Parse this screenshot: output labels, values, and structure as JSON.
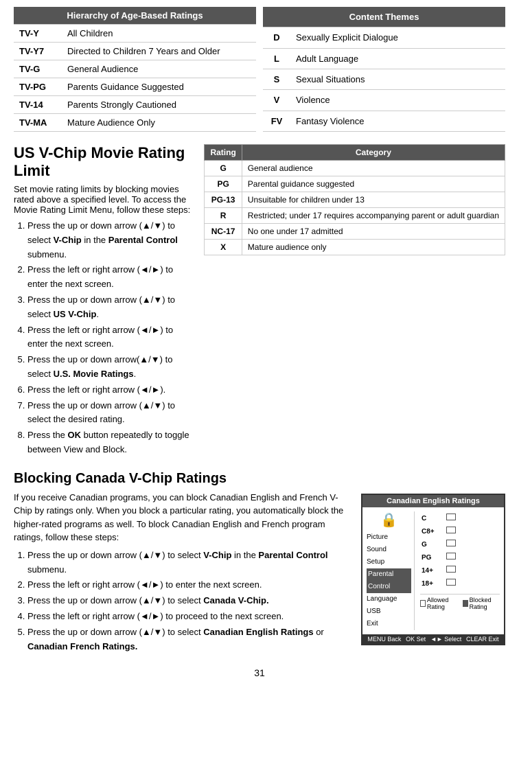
{
  "hierarchy_table": {
    "header": "Hierarchy of Age-Based Ratings",
    "rows": [
      {
        "rating": "TV-Y",
        "desc": "All Children"
      },
      {
        "rating": "TV-Y7",
        "desc": "Directed to Children 7 Years and Older"
      },
      {
        "rating": "TV-G",
        "desc": "General Audience"
      },
      {
        "rating": "TV-PG",
        "desc": "Parents Guidance Suggested"
      },
      {
        "rating": "TV-14",
        "desc": "Parents Strongly Cautioned"
      },
      {
        "rating": "TV-MA",
        "desc": "Mature Audience Only"
      }
    ]
  },
  "content_themes_table": {
    "header": "Content Themes",
    "rows": [
      {
        "rating": "D",
        "desc": "Sexually Explicit Dialogue"
      },
      {
        "rating": "L",
        "desc": "Adult Language"
      },
      {
        "rating": "S",
        "desc": "Sexual Situations"
      },
      {
        "rating": "V",
        "desc": "Violence"
      },
      {
        "rating": "FV",
        "desc": "Fantasy Violence"
      }
    ]
  },
  "vchip_section": {
    "title": "US V-Chip Movie Rating Limit",
    "subtitle": "Set movie rating limits by blocking movies rated above a specified level. To access the Movie Rating Limit Menu, follow these steps:",
    "steps": [
      "Press the up or down arrow (▲/▼) to select V-Chip in the Parental Control submenu.",
      "Press the left or right arrow (◄/►) to enter the next screen.",
      "Press the up or down arrow (▲/▼) to select US V-Chip.",
      "Press the left or right arrow (◄/►) to enter the next screen.",
      "Press the up or down arrow(▲/▼) to select U.S. Movie Ratings.",
      "Press the left or right arrow (◄/►).",
      "Press the up or down arrow (▲/▼) to select the desired rating.",
      "Press the OK button repeatedly to toggle between View and Block."
    ]
  },
  "movie_rating_table": {
    "col1": "Rating",
    "col2": "Category",
    "rows": [
      {
        "rating": "G",
        "category": "General audience"
      },
      {
        "rating": "PG",
        "category": "Parental guidance suggested"
      },
      {
        "rating": "PG-13",
        "category": "Unsuitable for children under 13"
      },
      {
        "rating": "R",
        "category": "Restricted; under 17 requires accompanying parent or adult guardian"
      },
      {
        "rating": "NC-17",
        "category": "No one under 17 admitted"
      },
      {
        "rating": "X",
        "category": "Mature audience only"
      }
    ]
  },
  "canada_section": {
    "title": "Blocking Canada V-Chip Ratings",
    "intro": "If you receive Canadian programs, you can block Canadian English and French V-Chip by ratings only. When you block a particular rating, you automatically block the higher-rated programs as well. To block Canadian English and French program ratings, follow these steps:",
    "steps": [
      "Press the up or down arrow (▲/▼) to select V-Chip in the Parental Control submenu.",
      "Press the left or right arrow (◄/►) to enter the next screen.",
      "Press the up or down arrow (▲/▼)  to select Canada V-Chip.",
      "Press the left or right arrow  (◄/►) to proceed to the next screen.",
      "Press the up or down arrow (▲/▼) to select Canadian English Ratings or Canadian French Ratings."
    ]
  },
  "canada_dialog": {
    "title": "Canadian English Ratings",
    "menu_items": [
      "Picture",
      "Sound",
      "Setup",
      "Parental Control",
      "Language",
      "USB",
      "Exit"
    ],
    "selected_item": "Parental Control",
    "ratings": [
      "C",
      "C8+",
      "G",
      "PG",
      "14+",
      "18+"
    ],
    "legend_allowed": "Allowed Rating",
    "legend_blocked": "Blocked Rating",
    "footer": [
      "MENU Back",
      "OK Set",
      "◄► Select",
      "CLEAR Exit"
    ]
  },
  "page_number": "31"
}
